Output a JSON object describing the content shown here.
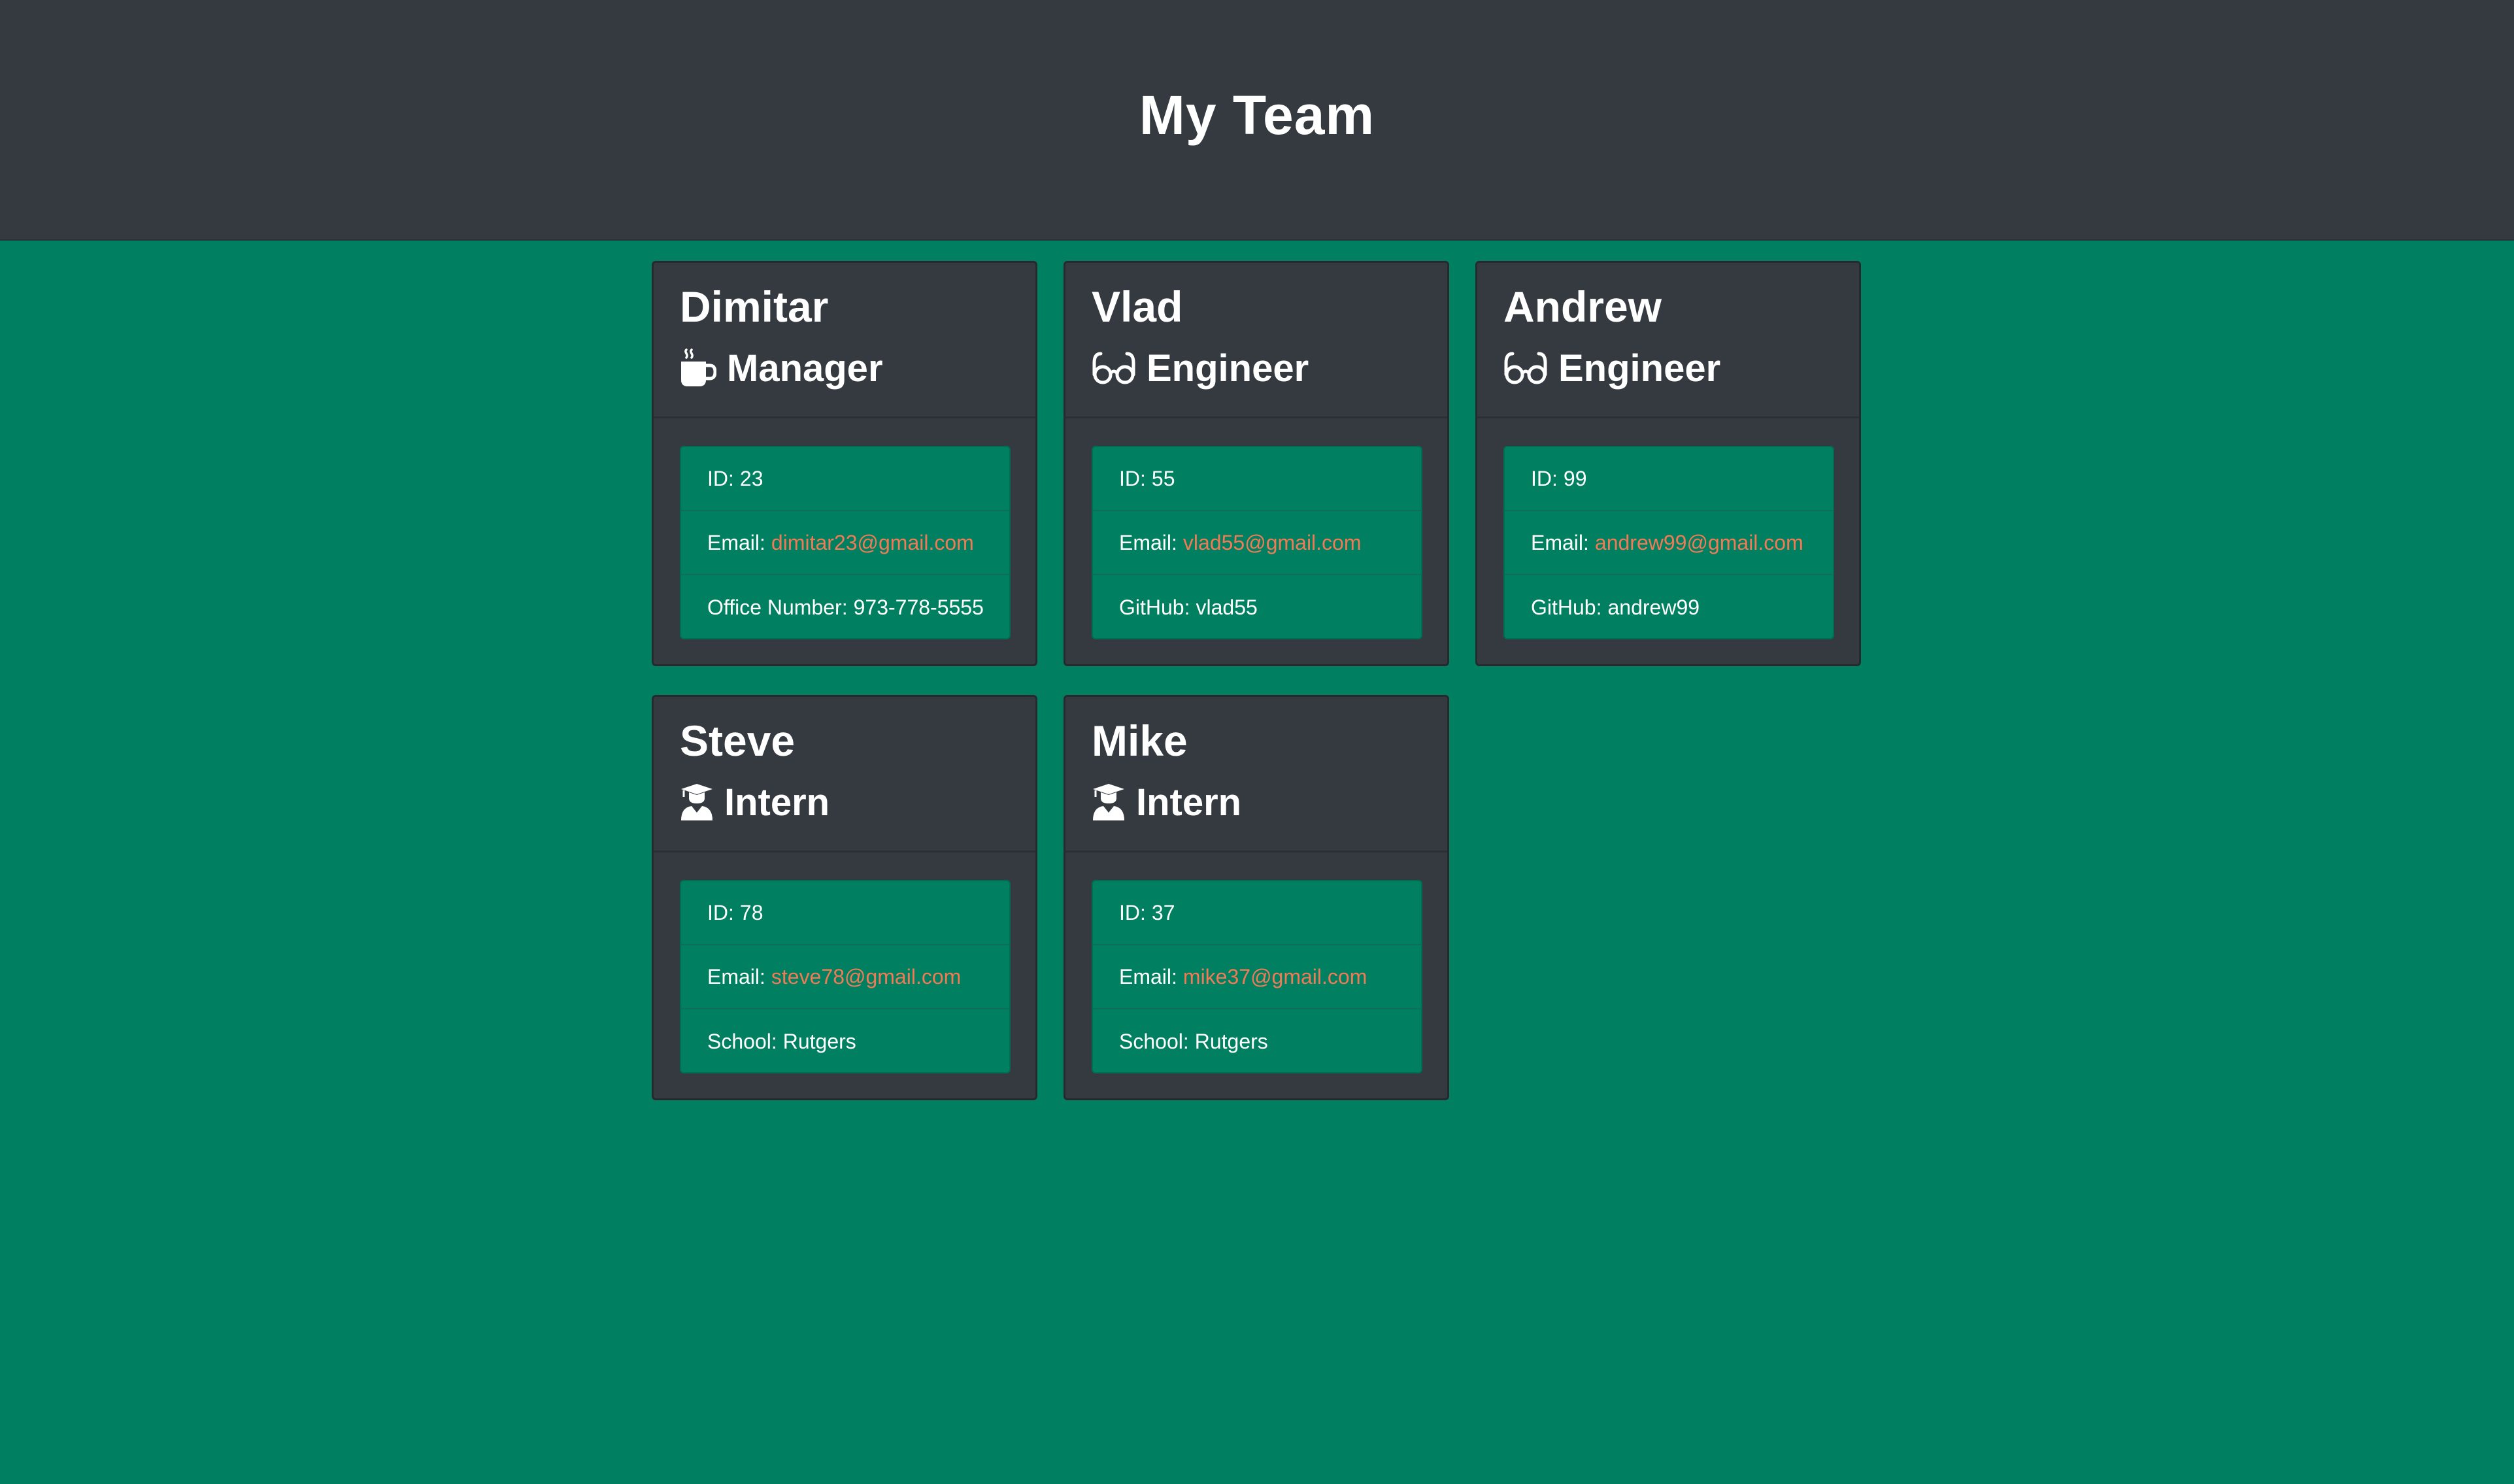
{
  "page": {
    "title": "My Team",
    "colors": {
      "background": "#008060",
      "header": "#343a40",
      "card": "#343a40",
      "email_link": "#f07a55"
    }
  },
  "labels": {
    "id": "ID:",
    "email": "Email:",
    "office": "Office Number:",
    "github": "GitHub:",
    "school": "School:"
  },
  "team": [
    {
      "name": "Dimitar",
      "role": "Manager",
      "icon": "coffee-mug-icon",
      "id": "23",
      "email": "dimitar23@gmail.com",
      "office_number": "973-778-5555"
    },
    {
      "name": "Vlad",
      "role": "Engineer",
      "icon": "glasses-icon",
      "id": "55",
      "email": "vlad55@gmail.com",
      "github": "vlad55"
    },
    {
      "name": "Andrew",
      "role": "Engineer",
      "icon": "glasses-icon",
      "id": "99",
      "email": "andrew99@gmail.com",
      "github": "andrew99"
    },
    {
      "name": "Steve",
      "role": "Intern",
      "icon": "graduate-icon",
      "id": "78",
      "email": "steve78@gmail.com",
      "school": "Rutgers"
    },
    {
      "name": "Mike",
      "role": "Intern",
      "icon": "graduate-icon",
      "id": "37",
      "email": "mike37@gmail.com",
      "school": "Rutgers"
    }
  ]
}
